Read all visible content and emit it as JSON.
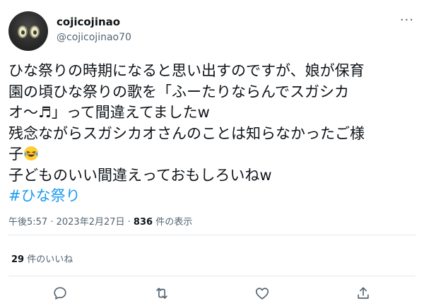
{
  "author": {
    "display_name": "cojicojinao",
    "handle": "@cojicojinao70",
    "avatar_icon": "avatar-image"
  },
  "more_icon": "more-dots-icon",
  "tweet": {
    "lines": [
      "ひな祭りの時期になると思い出すのですが、娘が保育",
      "園の頃ひな祭りの歌を「ふーたりならんでスガシカ",
      "オ〜♬」って間違えてましたw",
      "残念ながらスガシカオさんのことは知らなかったご様",
      "子",
      "子どものいい間違えっておもしろいねw"
    ],
    "emoji": "laughing-crying-emoji",
    "hashtag": "#ひな祭り"
  },
  "meta": {
    "time": "午後5:57",
    "sep1": " · ",
    "date": "2023年2月27日",
    "sep2": " · ",
    "views_count": "836",
    "views_label": " 件の表示"
  },
  "likes": {
    "count": "29",
    "label": " 件のいいね"
  },
  "actions": [
    {
      "name": "reply-icon"
    },
    {
      "name": "retweet-icon"
    },
    {
      "name": "like-icon"
    },
    {
      "name": "share-icon"
    }
  ],
  "colors": {
    "text": "#0f1419",
    "secondary": "#536471",
    "link": "#1d9bf0",
    "divider": "#e3e7ea"
  }
}
